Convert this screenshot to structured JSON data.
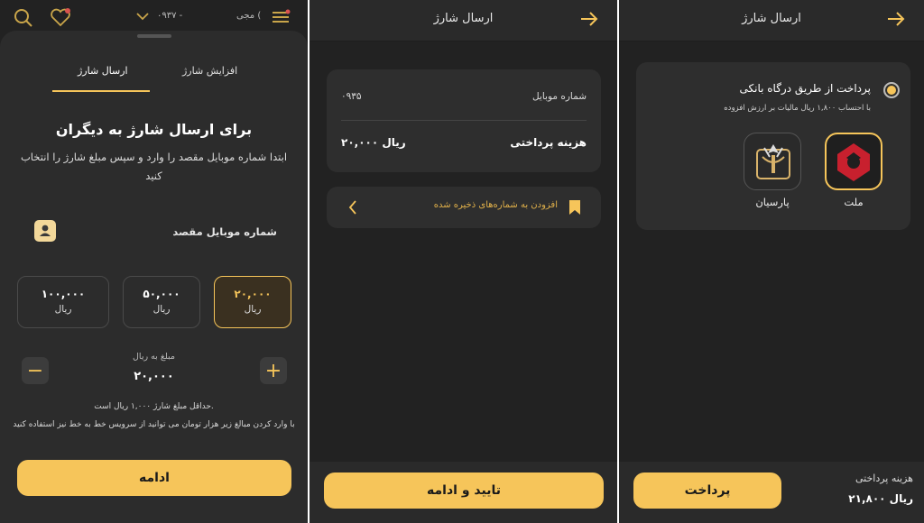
{
  "panel1": {
    "status_name": "مجی (",
    "status_phone": "۰۹۳۷ -",
    "tabs": {
      "increase": "افزایش شارژ",
      "send": "ارسال شارژ"
    },
    "title": "برای ارسال شارژ به دیگران",
    "subtitle_line1": "ابتدا شماره موبایل مقصد را وارد و سپس مبلغ شارژ را انتخاب",
    "subtitle_line2": "کنید",
    "dest_label": "شماره موبایل مقصد",
    "amounts": [
      {
        "value": "۱۰۰,۰۰۰",
        "currency": "ریال"
      },
      {
        "value": "۵۰,۰۰۰",
        "currency": "ریال"
      },
      {
        "value": "۲۰,۰۰۰",
        "currency": "ریال",
        "selected": true
      }
    ],
    "counter_label": "مبلغ به ریال",
    "counter_value": "۲۰,۰۰۰",
    "note1": "حداقل مبلغ شارژ ۱,۰۰۰ ریال است.",
    "note2": "با وارد کردن مبالغ زیر هزار تومان می توانید از سرویس خط به خط نیز استفاده کنید",
    "continue": "ادامه",
    "colors": {
      "accent": "#f6c55a",
      "bg": "#2c2c2c"
    }
  },
  "panel2": {
    "title": "ارسال شارژ",
    "mobile_label": "شماره موبایل",
    "mobile_value": "۰۹۳۵",
    "cost_label": "هزینه پرداختی",
    "cost_value": "۲۰,۰۰۰ ریال",
    "save_text": "افزودن به شماره‌های ذخیره شده",
    "confirm": "تایید و ادامه"
  },
  "panel3": {
    "title": "ارسال شارژ",
    "pay_method": "پرداخت از طریق درگاه بانکی",
    "tax_note": "با احتساب ۱,۸۰۰ ریال مالیات بر ارزش افزوده",
    "banks": [
      {
        "name": "ملت"
      },
      {
        "name": "پارسیان"
      }
    ],
    "pay": "پرداخت",
    "cost_label": "هزینه پرداختی",
    "cost_value": "۲۱,۸۰۰ ریال"
  }
}
